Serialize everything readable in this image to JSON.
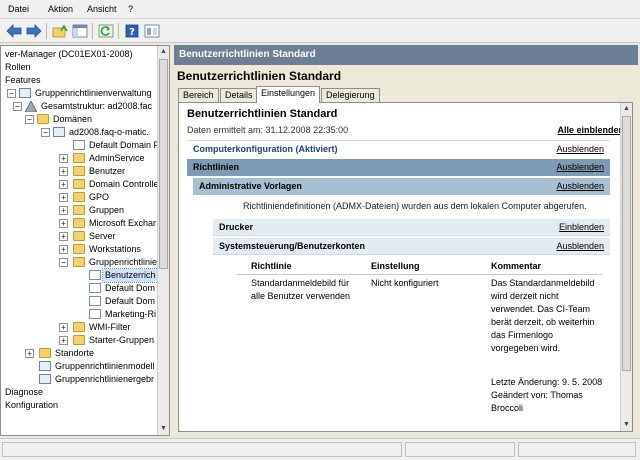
{
  "menu": [
    "Datei",
    "Aktion",
    "Ansicht",
    "?"
  ],
  "toolbar": {
    "icons": [
      "back-arrow-icon",
      "forward-arrow-icon",
      "up-folder-icon",
      "show-hide-tree-icon",
      "refresh-icon",
      "help-icon",
      "console-view-icon"
    ],
    "colors": {
      "back": "#3d6fc4",
      "forward": "#3d6fc4",
      "refresh": "#2f9a3a",
      "help": "#2f5fb8"
    }
  },
  "tree": {
    "items": [
      "ver-Manager (DC01EX01-2008)",
      "Rollen",
      "Features",
      "Gruppenrichtlinienverwaltung",
      "Gesamtstruktur: ad2008.fac",
      "Domänen",
      "ad2008.faq-o-matic.",
      "Default Domain P",
      "AdminService",
      "Benutzer",
      "Domain Controlle",
      "GPO",
      "Gruppen",
      "Microsoft Exchar",
      "Server",
      "Workstations",
      "Gruppenrichtlinie",
      "Benutzerrich",
      "Default Dom",
      "Default Dom",
      "Marketing-Ri",
      "WMI-Filter",
      "Starter-Gruppen",
      "Standorte",
      "Gruppenrichtlinienmodell",
      "Gruppenrichtlinienergebr",
      "Diagnose",
      "Konfiguration"
    ],
    "selected_index": 17
  },
  "panel": {
    "header": "Benutzerrichtlinien Standard",
    "title": "Benutzerrichtlinien Standard",
    "tabs": [
      "Bereich",
      "Details",
      "Einstellungen",
      "Delegierung"
    ],
    "active_tab": "Einstellungen"
  },
  "report": {
    "title": "Benutzerrichtlinien Standard",
    "date": "Daten ermittelt am: 31.12.2008 22:35:00",
    "show_all": "Alle einblenden",
    "sections": {
      "computer": {
        "label": "Computerkonfiguration (Aktiviert)",
        "action": "Ausblenden"
      },
      "richtlinien": {
        "label": "Richtlinien",
        "action": "Ausblenden"
      },
      "admin": {
        "label": "Administrative Vorlagen",
        "action": "Ausblenden"
      },
      "drucker": {
        "label": "Drucker",
        "action": "Einblenden"
      },
      "system": {
        "label": "Systemsteuerung/Benutzerkonten",
        "action": "Ausblenden"
      }
    },
    "admx_note": "Richtliniendefinitionen (ADMX-Dateien) wurden aus dem lokalen Computer abgerufen.",
    "columns": [
      "Richtlinie",
      "Einstellung",
      "Kommentar"
    ],
    "row": {
      "policy_1": "Standardanmeldebild für",
      "policy_2": "alle Benutzer verwenden",
      "setting": "Nicht konfiguriert",
      "comment": [
        "Das Standardanmeldebild",
        "wird derzeit nicht",
        "verwendet. Das CI-Team",
        "berät derzeit, ob weiterhin",
        "das Firmenlogo",
        "vorgegeben wird."
      ],
      "change": [
        "Letzte Änderung: 9. 5. 2008",
        "Geändert von: Thomas",
        "Broccoli"
      ]
    },
    "colors": {
      "richtlinien_band": "#7d9cb4",
      "admin_band": "#a7bfd1",
      "sub_band": "#e3ebf2",
      "computer_text": "#1e3f8f",
      "header_bar": "#6d7f95"
    }
  }
}
